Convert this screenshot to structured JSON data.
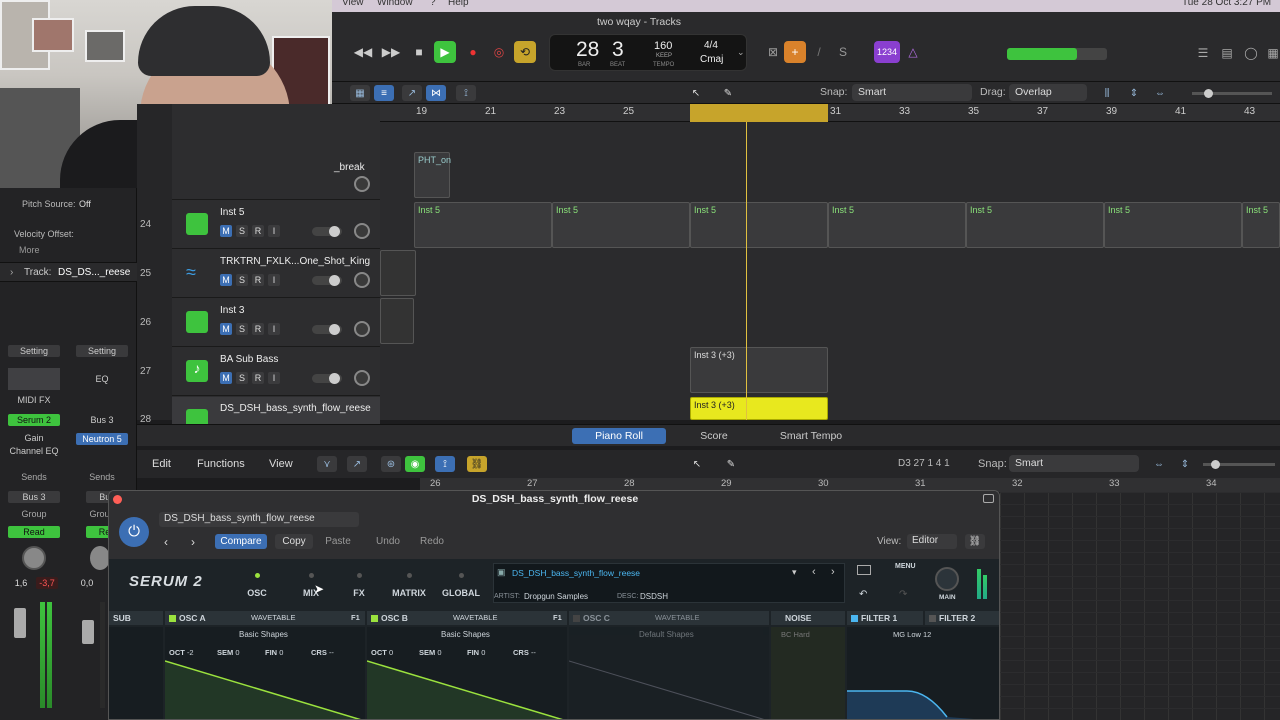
{
  "menubar": {
    "items": [
      "View",
      "Window",
      "?",
      "Help"
    ],
    "clock": "Tue 28 Oct 3:27 PM"
  },
  "window": {
    "title": "two wqay - Tracks"
  },
  "lcd": {
    "bar": "28",
    "beat": "3",
    "bar_label": "BAR",
    "beat_label": "BEAT",
    "tempo": "160",
    "tempo_mode": "KEEP",
    "tempo_label": "TEMPO",
    "sig": "4/4",
    "key": "Cmaj"
  },
  "transport": {
    "count_in": "1234"
  },
  "tracktoolbar": {
    "snap_label": "Snap:",
    "snap_value": "Smart",
    "drag_label": "Drag:",
    "drag_value": "Overlap"
  },
  "ruler": {
    "bars": [
      "19",
      "21",
      "23",
      "25",
      "27",
      "29",
      "31",
      "33",
      "35",
      "37",
      "39",
      "41",
      "43"
    ]
  },
  "tracks": [
    {
      "num": "",
      "name": "_break"
    },
    {
      "num": "24",
      "name": "Inst 5"
    },
    {
      "num": "25",
      "name": "TRKTRN_FXLK...One_Shot_King"
    },
    {
      "num": "26",
      "name": "Inst 3"
    },
    {
      "num": "27",
      "name": "BA Sub Bass"
    },
    {
      "num": "28",
      "name": "DS_DSH_bass_synth_flow_reese"
    }
  ],
  "msri": {
    "m": "M",
    "s": "S",
    "r": "R",
    "i": "I"
  },
  "regions": {
    "phton": "PHT_on",
    "inst5": "Inst 5",
    "inst3a": "Inst 3 (+3)",
    "inst3b": "Inst 3 (+3)"
  },
  "inspector": {
    "pitch_source_label": "Pitch Source:",
    "pitch_source": "Off",
    "velocity_offset": "Velocity Offset:",
    "more": "More",
    "track_label": "Track:",
    "track_name": "DS_DS..._reese"
  },
  "strip": {
    "setting": "Setting",
    "eq": "EQ",
    "midifx": "MIDI FX",
    "serum": "Serum 2",
    "neutron": "Neutron 5",
    "bus3": "Bus 3",
    "gain": "Gain",
    "channel_eq": "Channel EQ",
    "sends": "Sends",
    "bus3b": "Bus 3",
    "bus": "Bus",
    "group": "Group",
    "read": "Read",
    "read2": "Rea",
    "val1": "1,6",
    "val2": "-3,7",
    "val3": "0,0"
  },
  "pianoroll": {
    "tab_piano": "Piano Roll",
    "tab_score": "Score",
    "tab_tempo": "Smart Tempo",
    "edit": "Edit",
    "functions": "Functions",
    "view": "View",
    "position": "D3   27 1 4 1",
    "snap_label": "Snap:",
    "snap_value": "Smart",
    "ruler": [
      "26",
      "27",
      "28",
      "29",
      "30",
      "31",
      "32",
      "33",
      "34"
    ]
  },
  "plugin": {
    "title": "DS_DSH_bass_synth_flow_reese",
    "preset_menu": "DS_DSH_bass_synth_flow_reese",
    "compare": "Compare",
    "copy": "Copy",
    "paste": "Paste",
    "undo": "Undo",
    "redo": "Redo",
    "view_label": "View:",
    "view_value": "Editor"
  },
  "serum": {
    "logo": "SERUM 2",
    "tabs": [
      "OSC",
      "MIX",
      "FX",
      "MATRIX",
      "GLOBAL"
    ],
    "preset": "DS_DSH_bass_synth_flow_reese",
    "artist_label": "ARTIST:",
    "artist": "Dropgun Samples",
    "desc_label": "DESC:",
    "desc": "DSDSH",
    "menu": "MENU",
    "main": "MAIN",
    "osc": [
      {
        "name": "SUB"
      },
      {
        "name": "OSC A",
        "type": "WAVETABLE",
        "table": "Basic Shapes",
        "oct": "-2",
        "sem": "0",
        "fin": "0",
        "crs": "--"
      },
      {
        "name": "OSC B",
        "type": "WAVETABLE",
        "table": "Basic Shapes",
        "oct": "0",
        "sem": "0",
        "fin": "0",
        "crs": "--"
      },
      {
        "name": "OSC C",
        "type": "WAVETABLE",
        "table": "Default Shapes"
      },
      {
        "name": "NOISE",
        "table": "BC Hard"
      },
      {
        "name": "FILTER 1",
        "table": "MG Low 12"
      },
      {
        "name": "FILTER 2"
      }
    ],
    "labels": {
      "oct": "OCT",
      "sem": "SEM",
      "fin": "FIN",
      "crs": "CRS",
      "f1": "F1"
    }
  },
  "colors": {
    "accent": "#3c6fb4",
    "green": "#3ec33e",
    "yellow": "#e8e81e",
    "cycle": "#c7a42b"
  }
}
